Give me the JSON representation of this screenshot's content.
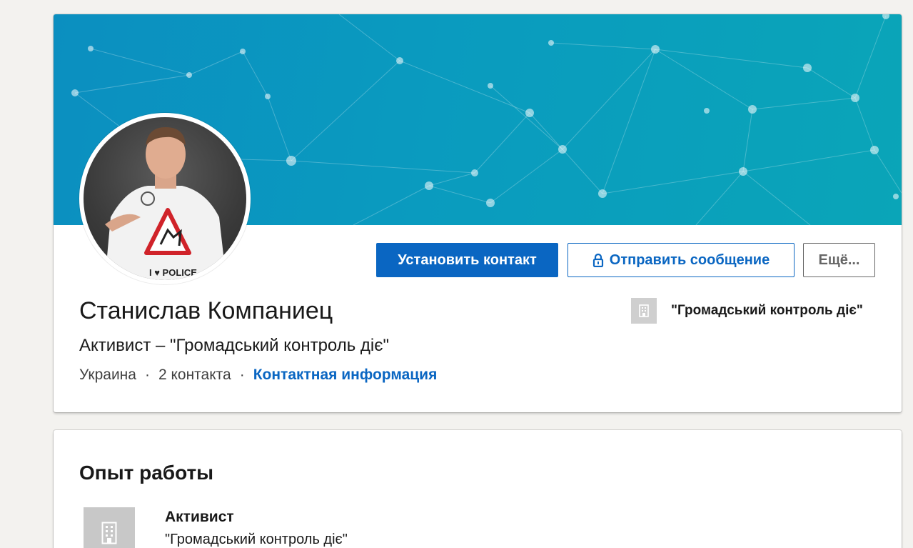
{
  "profile": {
    "name": "Станислав Компаниец",
    "headline": "Активист – \"Громадський контроль діє\"",
    "location": "Украина",
    "separator": "·",
    "connections": "2 контакта",
    "contact_info_label": "Контактная информация",
    "current_company": "\"Громадський контроль діє\"",
    "avatar_shirt_text": "I ♥ POLICE"
  },
  "actions": {
    "connect_label": "Установить контакт",
    "message_label": "Отправить сообщение",
    "more_label": "Ещё..."
  },
  "experience": {
    "section_title": "Опыт работы",
    "items": [
      {
        "title": "Активист",
        "company": "\"Громадський контроль діє\""
      }
    ]
  },
  "colors": {
    "primary": "#0a66c2",
    "banner_start": "#0b8fc0",
    "banner_end": "#0aa5b8",
    "page_bg": "#f3f2ef"
  },
  "icons": {
    "lock": "lock-icon",
    "company_placeholder": "building-icon"
  }
}
